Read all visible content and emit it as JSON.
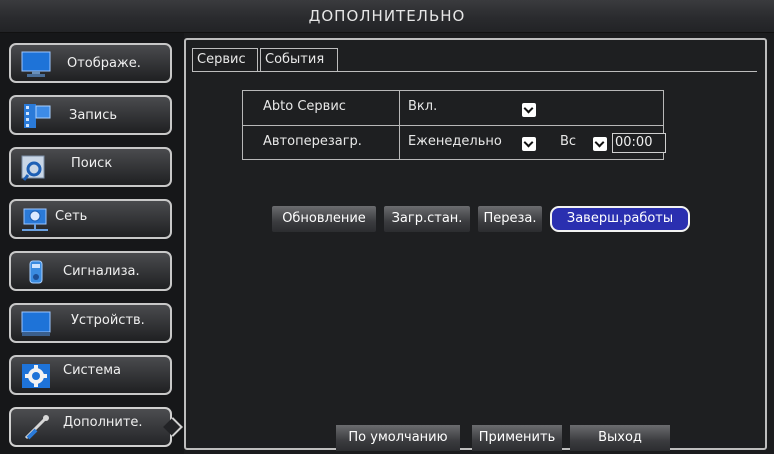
{
  "window": {
    "title": "ДОПОЛНИТЕЛЬНО"
  },
  "sidebar": {
    "items": [
      {
        "label": "Отображе.",
        "icon": "monitor-icon"
      },
      {
        "label": "Запись",
        "icon": "film-icon"
      },
      {
        "label": "Поиск",
        "icon": "magnifier-icon"
      },
      {
        "label": "Сеть",
        "icon": "network-icon"
      },
      {
        "label": "Сигнализа.",
        "icon": "alarm-icon"
      },
      {
        "label": "Устройств.",
        "icon": "device-icon"
      },
      {
        "label": "Система",
        "icon": "gear-icon"
      },
      {
        "label": "Дополните.",
        "icon": "wrench-icon",
        "active": true
      }
    ]
  },
  "tabs": [
    {
      "label": "Сервис",
      "active": true
    },
    {
      "label": "События",
      "active": false
    }
  ],
  "settings": {
    "auto_service": {
      "label": "Abto Сервис",
      "value": "Вкл."
    },
    "auto_reboot": {
      "label": "Автоперезагр.",
      "period": "Еженедельно",
      "day": "Вс",
      "time": "00:00"
    }
  },
  "actions": {
    "update": "Обновление",
    "load_defaults": "Загр.стан.",
    "restart": "Переза.",
    "shutdown": "Заверш.работы"
  },
  "footer": {
    "default": "По умолчанию",
    "apply": "Применить",
    "exit": "Выход"
  },
  "colors": {
    "selected_button": "#2a2fb0",
    "panel_border": "#bdbdbd",
    "background": "#1b1c1e"
  }
}
